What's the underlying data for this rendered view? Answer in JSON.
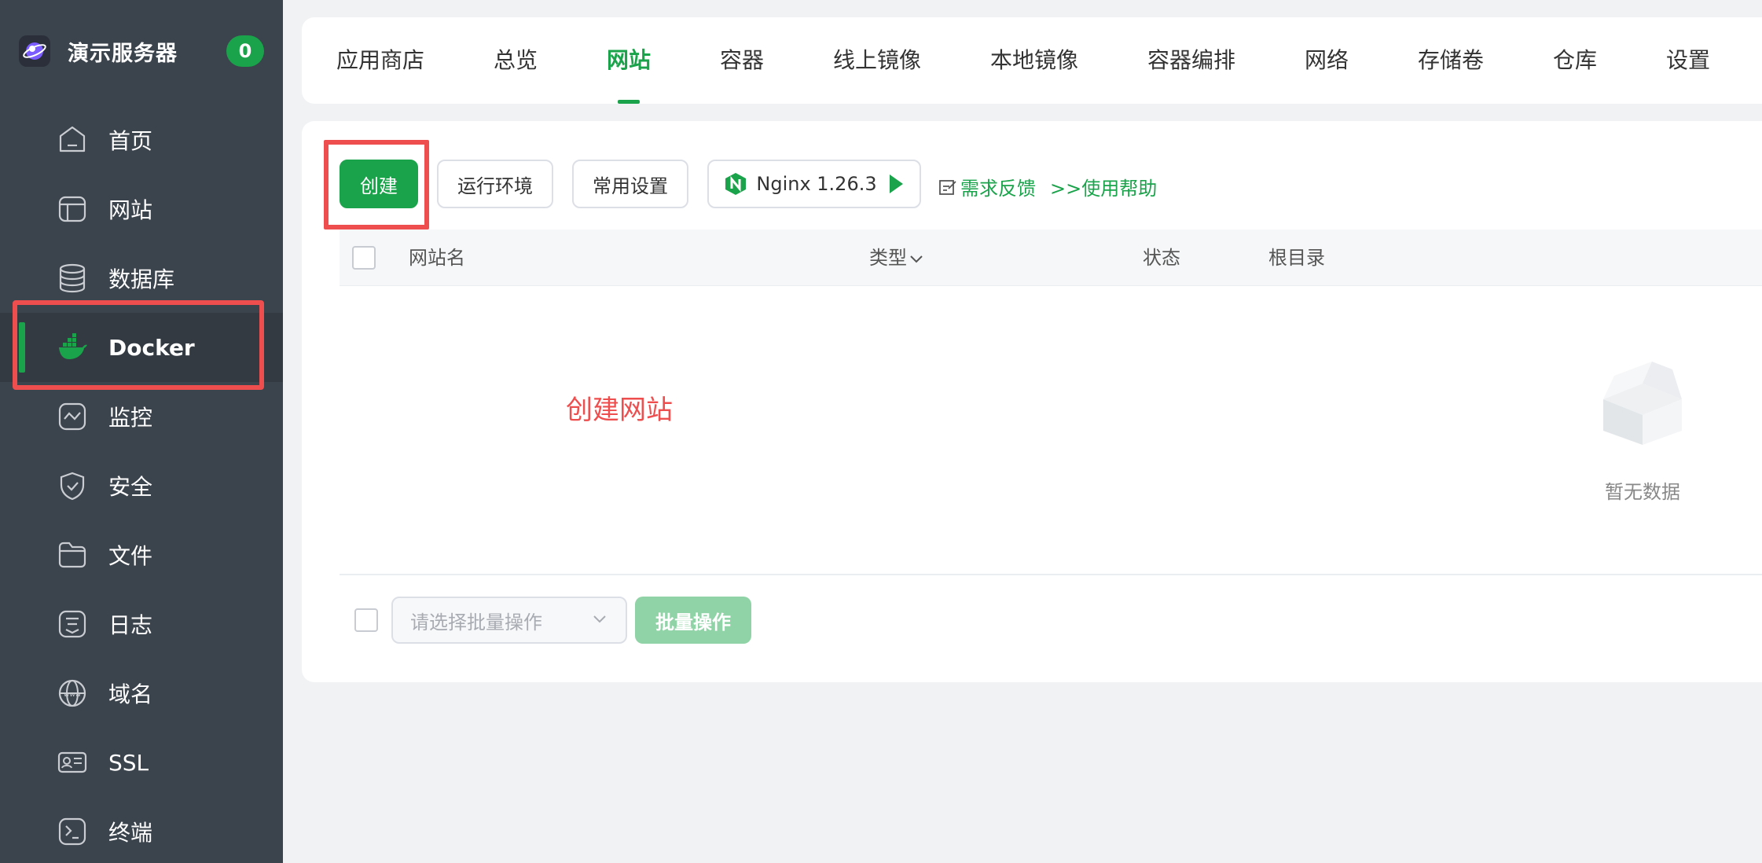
{
  "brand": {
    "name": "演示服务器",
    "badge": "0"
  },
  "sidebar": {
    "items": [
      {
        "label": "首页",
        "icon": "home-icon"
      },
      {
        "label": "网站",
        "icon": "website-icon"
      },
      {
        "label": "数据库",
        "icon": "database-icon"
      },
      {
        "label": "Docker",
        "icon": "docker-icon",
        "active": true
      },
      {
        "label": "监控",
        "icon": "monitor-icon"
      },
      {
        "label": "安全",
        "icon": "shield-icon"
      },
      {
        "label": "文件",
        "icon": "folder-icon"
      },
      {
        "label": "日志",
        "icon": "log-icon"
      },
      {
        "label": "域名",
        "icon": "globe-icon"
      },
      {
        "label": "SSL",
        "icon": "certificate-icon"
      },
      {
        "label": "终端",
        "icon": "terminal-icon"
      }
    ]
  },
  "tabs": [
    {
      "label": "应用商店"
    },
    {
      "label": "总览"
    },
    {
      "label": "网站",
      "active": true
    },
    {
      "label": "容器"
    },
    {
      "label": "线上镜像"
    },
    {
      "label": "本地镜像"
    },
    {
      "label": "容器编排"
    },
    {
      "label": "网络"
    },
    {
      "label": "存储卷"
    },
    {
      "label": "仓库"
    },
    {
      "label": "设置"
    }
  ],
  "toolbar": {
    "create": "创建",
    "runtime": "运行环境",
    "settings": "常用设置",
    "nginx": "Nginx 1.26.3",
    "feedback": "需求反馈",
    "help": ">>使用帮助"
  },
  "table": {
    "headers": {
      "name": "网站名",
      "type": "类型",
      "status": "状态",
      "root": "根目录"
    },
    "empty": "暂无数据"
  },
  "annotation": {
    "label": "创建网站"
  },
  "batch": {
    "placeholder": "请选择批量操作",
    "button": "批量操作"
  },
  "colors": {
    "accent": "#1aa34a",
    "sidebar": "#3b434c",
    "annotation": "#ef4e4e"
  }
}
